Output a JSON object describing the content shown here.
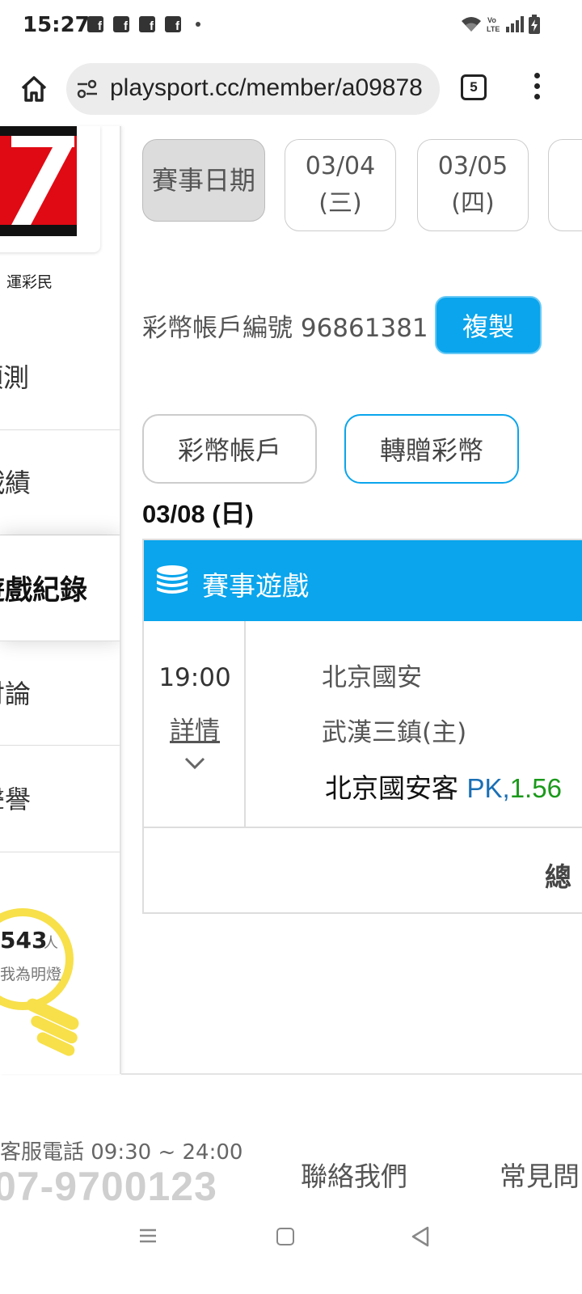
{
  "status_bar": {
    "time": "15:27",
    "notification_icons": [
      "f",
      "f",
      "f",
      "f"
    ],
    "signal_labels": "Vo LTE"
  },
  "browser": {
    "url": "playsport.cc/member/a09878",
    "tab_count": "5"
  },
  "sidebar": {
    "caption": "運彩民",
    "items": [
      {
        "label": "預測"
      },
      {
        "label": "戰績"
      },
      {
        "label": "遊戲紀錄",
        "active": true
      },
      {
        "label": "討論"
      },
      {
        "label": "聲譽"
      }
    ],
    "lightbulb": {
      "count": "543",
      "unit": "人",
      "text": "我為明燈"
    }
  },
  "dates": {
    "label": "賽事日期",
    "options": [
      {
        "date": "03/04",
        "weekday": "(三)"
      },
      {
        "date": "03/05",
        "weekday": "(四)"
      }
    ]
  },
  "account": {
    "label": "彩幣帳戶編號 96861381",
    "copy_button": "複製"
  },
  "tabs": {
    "coin_account": "彩幣帳戶",
    "transfer_coins": "轉贈彩幣"
  },
  "day_label": "03/08 (日)",
  "game": {
    "header": "賽事遊戲",
    "time": "19:00",
    "detail_link": "詳情",
    "team_away": "北京國安",
    "team_home": "武漢三鎮(主)",
    "bet_team": "北京國安客",
    "bet_type": "PK,",
    "bet_odds": "1.56",
    "total_label": "總"
  },
  "footer": {
    "service_hours": "客服電話 09:30 ~ 24:00",
    "phone": "07-9700123",
    "contact": "聯絡我們",
    "faq": "常見問"
  },
  "colors": {
    "accent": "#0aa5ec",
    "logo_red": "#e00a14",
    "odds_green": "#1a9a1a",
    "pk_blue": "#1a6fb5",
    "bulb_yellow": "#f7e04a"
  }
}
